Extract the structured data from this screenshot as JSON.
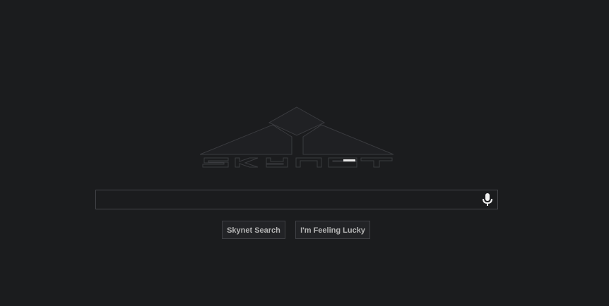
{
  "logo": {
    "text": "SKYNET",
    "colors": {
      "stroke": "#3a3b3f",
      "fill": "#202124",
      "highlight": "#e8e8e8"
    }
  },
  "search": {
    "value": "",
    "placeholder": "",
    "mic_icon": "microphone-icon"
  },
  "buttons": {
    "search_label": "Skynet Search",
    "lucky_label": "I'm Feeling Lucky"
  },
  "colors": {
    "background": "#1b1c1e",
    "border": "#45464a",
    "button_text": "#b4b4b4"
  }
}
